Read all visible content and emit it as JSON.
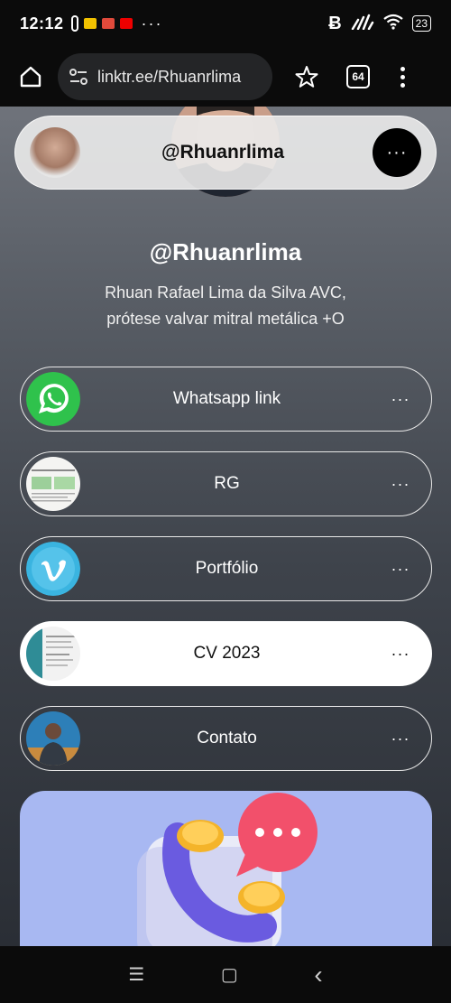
{
  "status_bar": {
    "time": "12:12",
    "battery": "23",
    "more_indicator": "···"
  },
  "browser": {
    "url": "linktr.ee/Rhuanrlima",
    "tab_count": "64"
  },
  "profile": {
    "sticky_handle": "@Rhuanrlima",
    "name": "@Rhuanrlima",
    "bio_line1": "Rhuan Rafael Lima da Silva AVC,",
    "bio_line2": "prótese valvar mitral metálica +O"
  },
  "links": [
    {
      "label": "Whatsapp link",
      "icon": "whatsapp-icon"
    },
    {
      "label": "RG",
      "icon": "document-thumbnail"
    },
    {
      "label": "Portfólio",
      "icon": "vimeo-icon"
    },
    {
      "label": "CV 2023",
      "icon": "cv-thumbnail"
    },
    {
      "label": "Contato",
      "icon": "person-photo"
    }
  ],
  "more_glyph": "···",
  "nav": {
    "recents": "☰",
    "home": "▢",
    "back": "‹"
  }
}
